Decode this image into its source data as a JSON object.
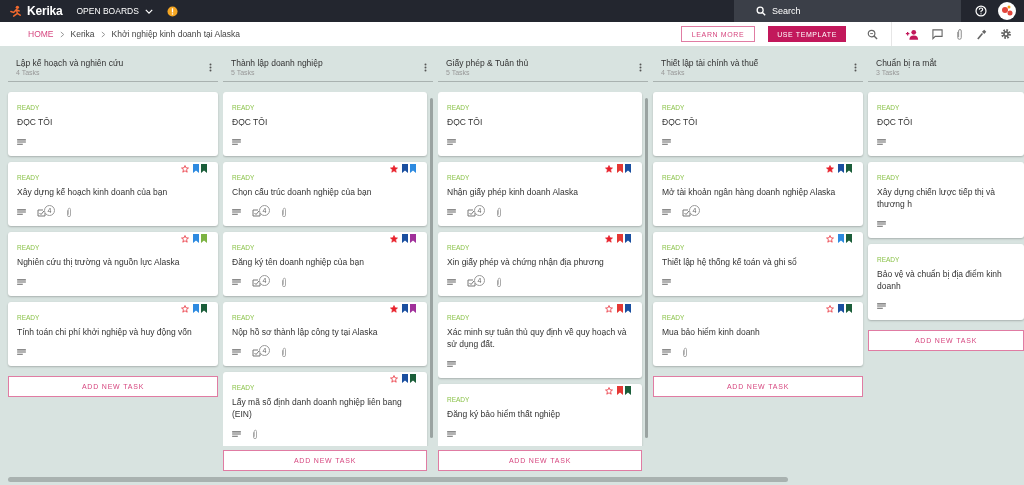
{
  "topbar": {
    "logo": "Kerika",
    "boards_menu": "OPEN BOARDS",
    "search": {
      "placeholder": "Search"
    }
  },
  "breadcrumb": [
    {
      "label": "HOME",
      "kind": "link"
    },
    {
      "label": "Kerika",
      "kind": "crumb"
    },
    {
      "label": "Khởi nghiệp kinh doanh tại Alaska",
      "kind": "crumb"
    }
  ],
  "actions": {
    "learn_more": "LEARN MORE",
    "use_template": "USE TEMPLATE"
  },
  "columns": [
    {
      "title": "Lập kế hoạch và nghiên cứu",
      "count": "4 Tasks",
      "add_label": "ADD NEW TASK",
      "tasks": [
        {
          "status": "READY",
          "title": "ĐỌC TÔI",
          "description": true,
          "attachment": false
        },
        {
          "status": "READY",
          "title": "Xây dựng kế hoạch kinh doanh của bạn",
          "flags": {
            "starred": false,
            "tags": [
              {
                "color": "#2d8ae0"
              },
              {
                "color": "#1b5e3a"
              }
            ]
          },
          "description": true,
          "checklist": "4",
          "attachment": true
        },
        {
          "status": "READY",
          "title": "Nghiên cứu thị trường và nguồn lực Alaska",
          "flags": {
            "starred": false,
            "tags": [
              {
                "color": "#2d8ae0"
              },
              {
                "color": "#7cb342"
              }
            ]
          },
          "description": true,
          "attachment": false
        },
        {
          "status": "READY",
          "title": "Tính toán chi phí khởi nghiệp và huy động vốn",
          "flags": {
            "starred": false,
            "tags": [
              {
                "color": "#2d8ae0"
              },
              {
                "color": "#1b5e3a"
              }
            ]
          },
          "description": true,
          "attachment": false
        }
      ]
    },
    {
      "title": "Thành lập doanh nghiệp",
      "count": "5 Tasks",
      "add_label": "ADD NEW TASK",
      "tasks": [
        {
          "status": "READY",
          "title": "ĐỌC TÔI",
          "description": true,
          "attachment": false
        },
        {
          "status": "READY",
          "title": "Chọn cấu trúc doanh nghiệp của bạn",
          "flags": {
            "starred": true,
            "tags": [
              {
                "color": "#1a4fa0"
              },
              {
                "color": "#2d8ae0"
              }
            ]
          },
          "description": true,
          "checklist": "4",
          "attachment": true
        },
        {
          "status": "READY",
          "title": "Đăng ký tên doanh nghiệp của bạn",
          "flags": {
            "starred": true,
            "tags": [
              {
                "color": "#1a4fa0"
              },
              {
                "color": "#a0309a"
              }
            ]
          },
          "description": true,
          "checklist": "4",
          "attachment": true
        },
        {
          "status": "READY",
          "title": "Nộp hồ sơ thành lập công ty tại Alaska",
          "flags": {
            "starred": true,
            "tags": [
              {
                "color": "#1a4fa0"
              },
              {
                "color": "#a0309a"
              }
            ]
          },
          "description": true,
          "checklist": "4",
          "attachment": true
        },
        {
          "status": "READY",
          "title": "Lấy mã số định danh doanh nghiệp liên bang (EIN)",
          "flags": {
            "starred": false,
            "tags": [
              {
                "color": "#1a4fa0"
              },
              {
                "color": "#1b5e3a"
              }
            ]
          },
          "description": true,
          "attachment": true
        }
      ]
    },
    {
      "title": "Giấy phép & Tuân thủ",
      "count": "5 Tasks",
      "add_label": "ADD NEW TASK",
      "tasks": [
        {
          "status": "READY",
          "title": "ĐỌC TÔI",
          "description": true,
          "attachment": false
        },
        {
          "status": "READY",
          "title": "Nhận giấy phép kinh doanh Alaska",
          "flags": {
            "starred": true,
            "tags": [
              {
                "color": "#e53935"
              },
              {
                "color": "#1a4fa0"
              }
            ]
          },
          "description": true,
          "checklist": "4",
          "attachment": true
        },
        {
          "status": "READY",
          "title": "Xin giấy phép và chứng nhận địa phương",
          "flags": {
            "starred": true,
            "tags": [
              {
                "color": "#e53935"
              },
              {
                "color": "#1a4fa0"
              }
            ]
          },
          "description": true,
          "checklist": "4",
          "attachment": true
        },
        {
          "status": "READY",
          "title": "Xác minh sự tuân thủ quy định về quy hoạch và sử dụng đất.",
          "flags": {
            "starred": false,
            "tags": [
              {
                "color": "#e53935"
              },
              {
                "color": "#1a4fa0"
              }
            ]
          },
          "description": true,
          "attachment": false
        },
        {
          "status": "READY",
          "title": "Đăng ký bảo hiểm thất nghiệp",
          "flags": {
            "starred": false,
            "tags": [
              {
                "color": "#e53935"
              },
              {
                "color": "#1b5e3a"
              }
            ]
          },
          "description": true,
          "attachment": false
        }
      ]
    },
    {
      "title": "Thiết lập tài chính và thuế",
      "count": "4 Tasks",
      "add_label": "ADD NEW TASK",
      "tasks": [
        {
          "status": "READY",
          "title": "ĐỌC TÔI",
          "description": true,
          "attachment": false
        },
        {
          "status": "READY",
          "title": "Mở tài khoản ngân hàng doanh nghiệp Alaska",
          "flags": {
            "starred": true,
            "tags": [
              {
                "color": "#1a4fa0"
              },
              {
                "color": "#1b5e3a"
              }
            ]
          },
          "description": true,
          "checklist": "4",
          "attachment": false
        },
        {
          "status": "READY",
          "title": "Thiết lập hệ thống kế toán và ghi sổ",
          "flags": {
            "starred": false,
            "tags": [
              {
                "color": "#2d8ae0"
              },
              {
                "color": "#1b5e3a"
              }
            ]
          },
          "description": true,
          "attachment": false
        },
        {
          "status": "READY",
          "title": "Mua bảo hiểm kinh doanh",
          "flags": {
            "starred": false,
            "tags": [
              {
                "color": "#1a4fa0"
              },
              {
                "color": "#1b5e3a"
              }
            ]
          },
          "description": true,
          "attachment": true
        }
      ]
    },
    {
      "title": "Chuẩn bị ra mắt",
      "count": "3 Tasks",
      "add_label": "ADD NEW TASK",
      "tasks": [
        {
          "status": "READY",
          "title": "ĐỌC TÔI",
          "description": true,
          "attachment": false
        },
        {
          "status": "READY",
          "title": "Xây dựng chiến lược tiếp thị và thương h",
          "description": true,
          "attachment": false
        },
        {
          "status": "READY",
          "title": "Bảo vệ và chuẩn bị địa điểm kinh doanh",
          "description": true,
          "attachment": false
        }
      ]
    }
  ]
}
